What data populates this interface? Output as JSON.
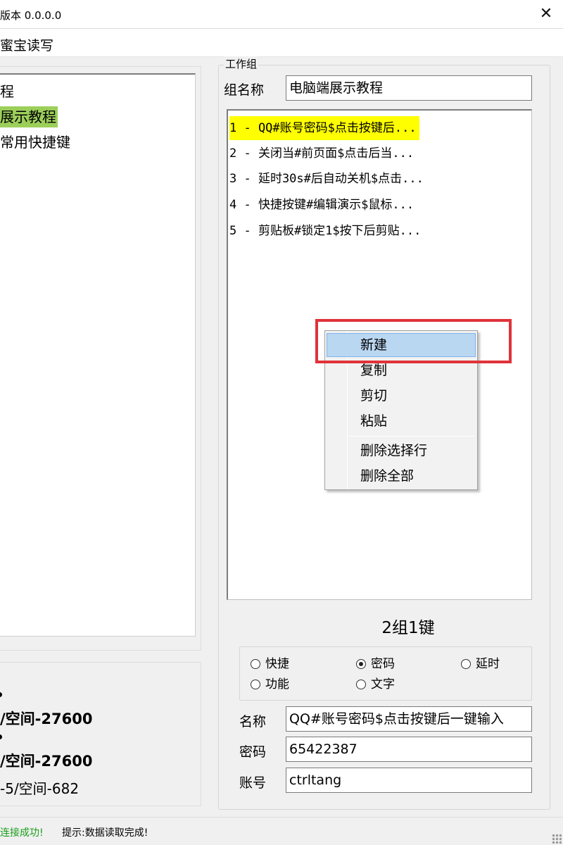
{
  "window": {
    "title": "版本 0.0.0.0",
    "close_glyph": "✕"
  },
  "menu": {
    "item": "蜜宝读写"
  },
  "tree": {
    "items": [
      {
        "label": "程",
        "selected": false
      },
      {
        "label": "展示教程",
        "selected": true
      },
      {
        "label": "常用快捷键",
        "selected": false
      }
    ]
  },
  "info": {
    "line1": "/空间-27600",
    "line2": "/空间-27600",
    "line3": "-5/空间-682"
  },
  "status": {
    "connection": "连接成功!",
    "hint": "提示:数据读取完成!"
  },
  "group": {
    "legend": "工作组",
    "name_label": "组名称",
    "name_value": "电脑端展示教程"
  },
  "list": {
    "items": [
      "1 - QQ#账号密码$点击按键后...",
      "2 - 关闭当#前页面$点击后当...",
      "3 - 延时30s#后自动关机$点击...",
      "4 - 快捷按键#编辑演示$鼠标...",
      "5 - 剪贴板#锁定1$按下后剪贴..."
    ],
    "selected_index": 0
  },
  "count_label": "2组1键",
  "key_type": {
    "options": [
      {
        "label": "快捷",
        "checked": false
      },
      {
        "label": "密码",
        "checked": true
      },
      {
        "label": "延时",
        "checked": false
      },
      {
        "label": "功能",
        "checked": false
      },
      {
        "label": "文字",
        "checked": false
      }
    ]
  },
  "fields": {
    "name_label": "名称",
    "name_value": "QQ#账号密码$点击按键后一键输入",
    "password_label": "密码",
    "password_value": "65422387",
    "account_label": "账号",
    "account_value": "ctrltang"
  },
  "context_menu": {
    "items": [
      "新建",
      "复制",
      "剪切",
      "粘贴",
      "删除选择行",
      "删除全部"
    ],
    "hovered_index": 0
  },
  "colors": {
    "tree_selection": "#9ccf5a",
    "list_selection": "#ffff00",
    "menu_hover": "#bad7f2",
    "highlight_box": "#e0323a",
    "status_ok": "#1a9e1a"
  }
}
